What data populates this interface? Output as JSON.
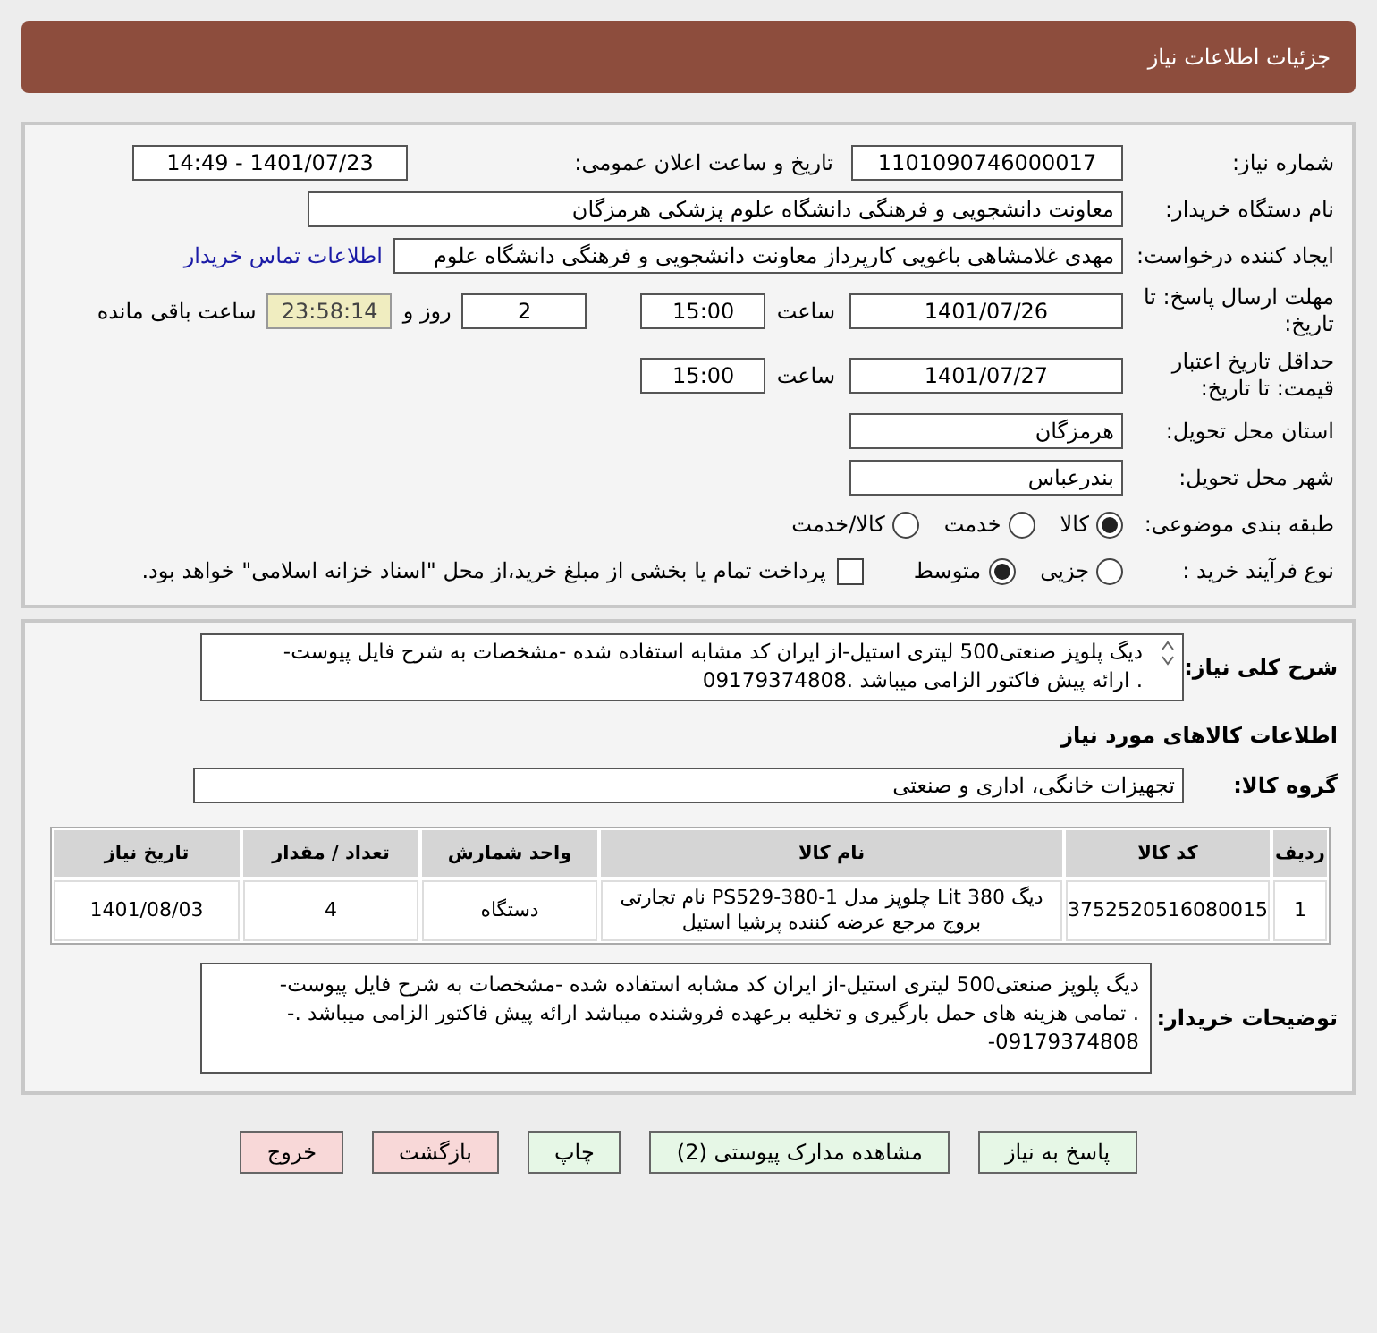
{
  "header": {
    "title": "جزئیات اطلاعات نیاز"
  },
  "need_number": {
    "label": "شماره نیاز:",
    "value": "1101090746000017"
  },
  "announce": {
    "label": "تاریخ و ساعت اعلان عمومی:",
    "value": "1401/07/23 - 14:49"
  },
  "buyer_org": {
    "label": "نام دستگاه خریدار:",
    "value": "معاونت دانشجویی و فرهنگی دانشگاه علوم پزشکی هرمزگان"
  },
  "requester": {
    "label": "ایجاد کننده درخواست:",
    "value": "مهدی غلامشاهی باغویی کارپرداز معاونت دانشجویی و فرهنگی دانشگاه علوم",
    "link": "اطلاعات تماس خریدار"
  },
  "deadline": {
    "label": "مهلت ارسال پاسخ: تا تاریخ:",
    "date": "1401/07/26",
    "time_label": "ساعت",
    "time": "15:00",
    "days": "2",
    "days_label": "روز و",
    "remaining": "23:58:14",
    "remaining_label": "ساعت باقی مانده"
  },
  "validity": {
    "label": "حداقل تاریخ اعتبار قیمت: تا تاریخ:",
    "date": "1401/07/27",
    "time_label": "ساعت",
    "time": "15:00"
  },
  "province": {
    "label": "استان محل تحویل:",
    "value": "هرمزگان"
  },
  "city": {
    "label": "شهر محل تحویل:",
    "value": "بندرعباس"
  },
  "category": {
    "label": "طبقه بندی موضوعی:",
    "options": [
      {
        "label": "کالا",
        "selected": true
      },
      {
        "label": "خدمت",
        "selected": false
      },
      {
        "label": "کالا/خدمت",
        "selected": false
      }
    ]
  },
  "process": {
    "label": "نوع فرآیند خرید :",
    "options": [
      {
        "label": "جزیی",
        "selected": false
      },
      {
        "label": "متوسط",
        "selected": true
      }
    ],
    "payment": {
      "label": "پرداخت تمام یا بخشی از مبلغ خرید،از محل \"اسناد خزانه اسلامی\" خواهد بود.",
      "checked": false
    }
  },
  "summary": {
    "label": "شرح کلی نیاز:",
    "text": "دیگ پلوپز صنعتی500 لیتری استیل-از ایران کد مشابه استفاده شده -مشخصات به شرح فایل پیوست-\n. ارائه پیش فاکتور الزامی میباشد .09179374808"
  },
  "goods_heading": "اطلاعات کالاهای مورد نیاز",
  "goods_group": {
    "label": "گروه کالا:",
    "value": "تجهیزات خانگی، اداری و صنعتی"
  },
  "table": {
    "columns": [
      "ردیف",
      "کد کالا",
      "نام کالا",
      "واحد شمارش",
      "تعداد / مقدار",
      "تاریخ نیاز"
    ],
    "rows": [
      [
        "1",
        "3752520516080015",
        "دیگ 380 Lit چلوپز مدل PS529-380-1 نام تجارتی بروج مرجع عرضه کننده پرشیا استیل",
        "دستگاه",
        "4",
        "1401/08/03"
      ]
    ]
  },
  "buyer_notes": {
    "label": "توضیحات خریدار:",
    "text": "دیگ پلوپز صنعتی500 لیتری استیل-از ایران کد مشابه استفاده شده -مشخصات به شرح فایل پیوست-\n. تمامی هزینه های حمل بارگیری و تخلیه   برعهده فروشنده میباشد ارائه پیش فاکتور الزامی میباشد .-\n09179374808-"
  },
  "buttons": [
    {
      "label": "پاسخ به نیاز",
      "kind": "normal"
    },
    {
      "label": "مشاهده مدارک پیوستی (2)",
      "kind": "normal"
    },
    {
      "label": "چاپ",
      "kind": "normal"
    },
    {
      "label": "بازگشت",
      "kind": "danger"
    },
    {
      "label": "خروج",
      "kind": "danger"
    }
  ]
}
